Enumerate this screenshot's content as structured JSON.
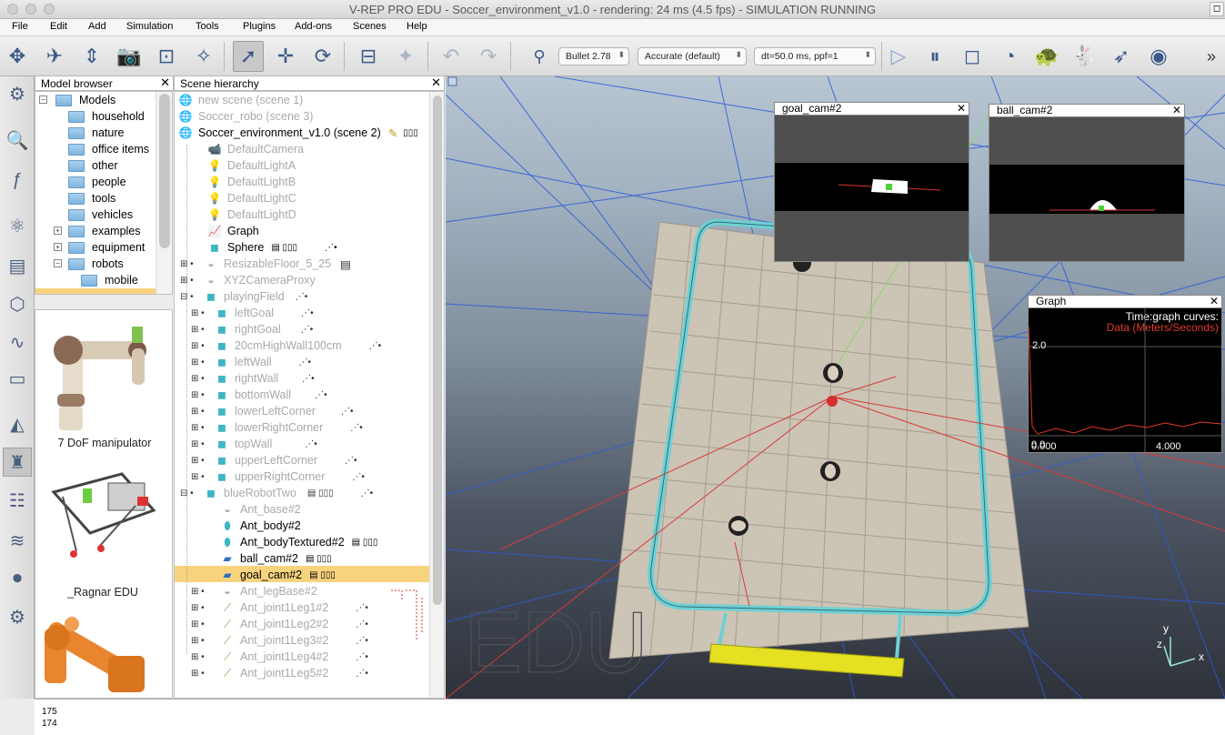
{
  "window": {
    "title": "V-REP PRO EDU - Soccer_environment_v1.0 - rendering: 24 ms (4.5 fps) - SIMULATION RUNNING"
  },
  "menu": [
    "File",
    "Edit",
    "Add",
    "Simulation",
    "Tools",
    "Plugins",
    "Add-ons",
    "Scenes",
    "Help"
  ],
  "toolbar": {
    "engine": "Bullet 2.78",
    "accuracy": "Accurate (default)",
    "timestep": "dt=50.0 ms, ppf=1"
  },
  "model_browser": {
    "title": "Model browser",
    "root": "Models",
    "folders": [
      "household",
      "nature",
      "office items",
      "other",
      "people",
      "tools",
      "vehicles",
      "examples",
      "equipment",
      "robots",
      "mobile"
    ],
    "thumbnails": [
      "7 DoF manipulator",
      "_Ragnar EDU"
    ]
  },
  "scene_hierarchy": {
    "title": "Scene hierarchy",
    "scenes": [
      "new scene (scene 1)",
      "Soccer_robo (scene 3)",
      "Soccer_environment_v1.0 (scene 2)"
    ],
    "items": [
      "DefaultCamera",
      "DefaultLightA",
      "DefaultLightB",
      "DefaultLightC",
      "DefaultLightD",
      "Graph",
      "Sphere",
      "ResizableFloor_5_25",
      "XYZCameraProxy",
      "playingField",
      "leftGoal",
      "rightGoal",
      "20cmHighWall100cm",
      "leftWall",
      "rightWall",
      "bottomWall",
      "lowerLeftCorner",
      "lowerRightCorner",
      "topWall",
      "upperLeftCorner",
      "upperRightCorner",
      "blueRobotTwo",
      "Ant_base#2",
      "Ant_body#2",
      "Ant_bodyTextured#2",
      "ball_cam#2",
      "goal_cam#2",
      "Ant_legBase#2",
      "Ant_joint1Leg1#2",
      "Ant_joint1Leg2#2",
      "Ant_joint1Leg3#2",
      "Ant_joint1Leg4#2",
      "Ant_joint1Leg5#2"
    ]
  },
  "viewport": {
    "watermark": "EDU",
    "goal_cam_title": "goal_cam#2",
    "ball_cam_title": "ball_cam#2",
    "graph": {
      "title": "Graph",
      "label1": "Time:graph curves:",
      "label2": "Data (Meters/Seconds)",
      "y_tick": "2.0",
      "y_zero": "0.0",
      "x_zero": "0.000",
      "x_tick": "4.000"
    },
    "axes": {
      "y": "y",
      "z": "z",
      "x": "x"
    }
  },
  "console": [
    "175",
    "174"
  ],
  "colors": {
    "selection": "#f8d37e",
    "graph_curve": "#e03a2a",
    "goal": "#e5e021",
    "field_border": "#6fd0d4"
  }
}
